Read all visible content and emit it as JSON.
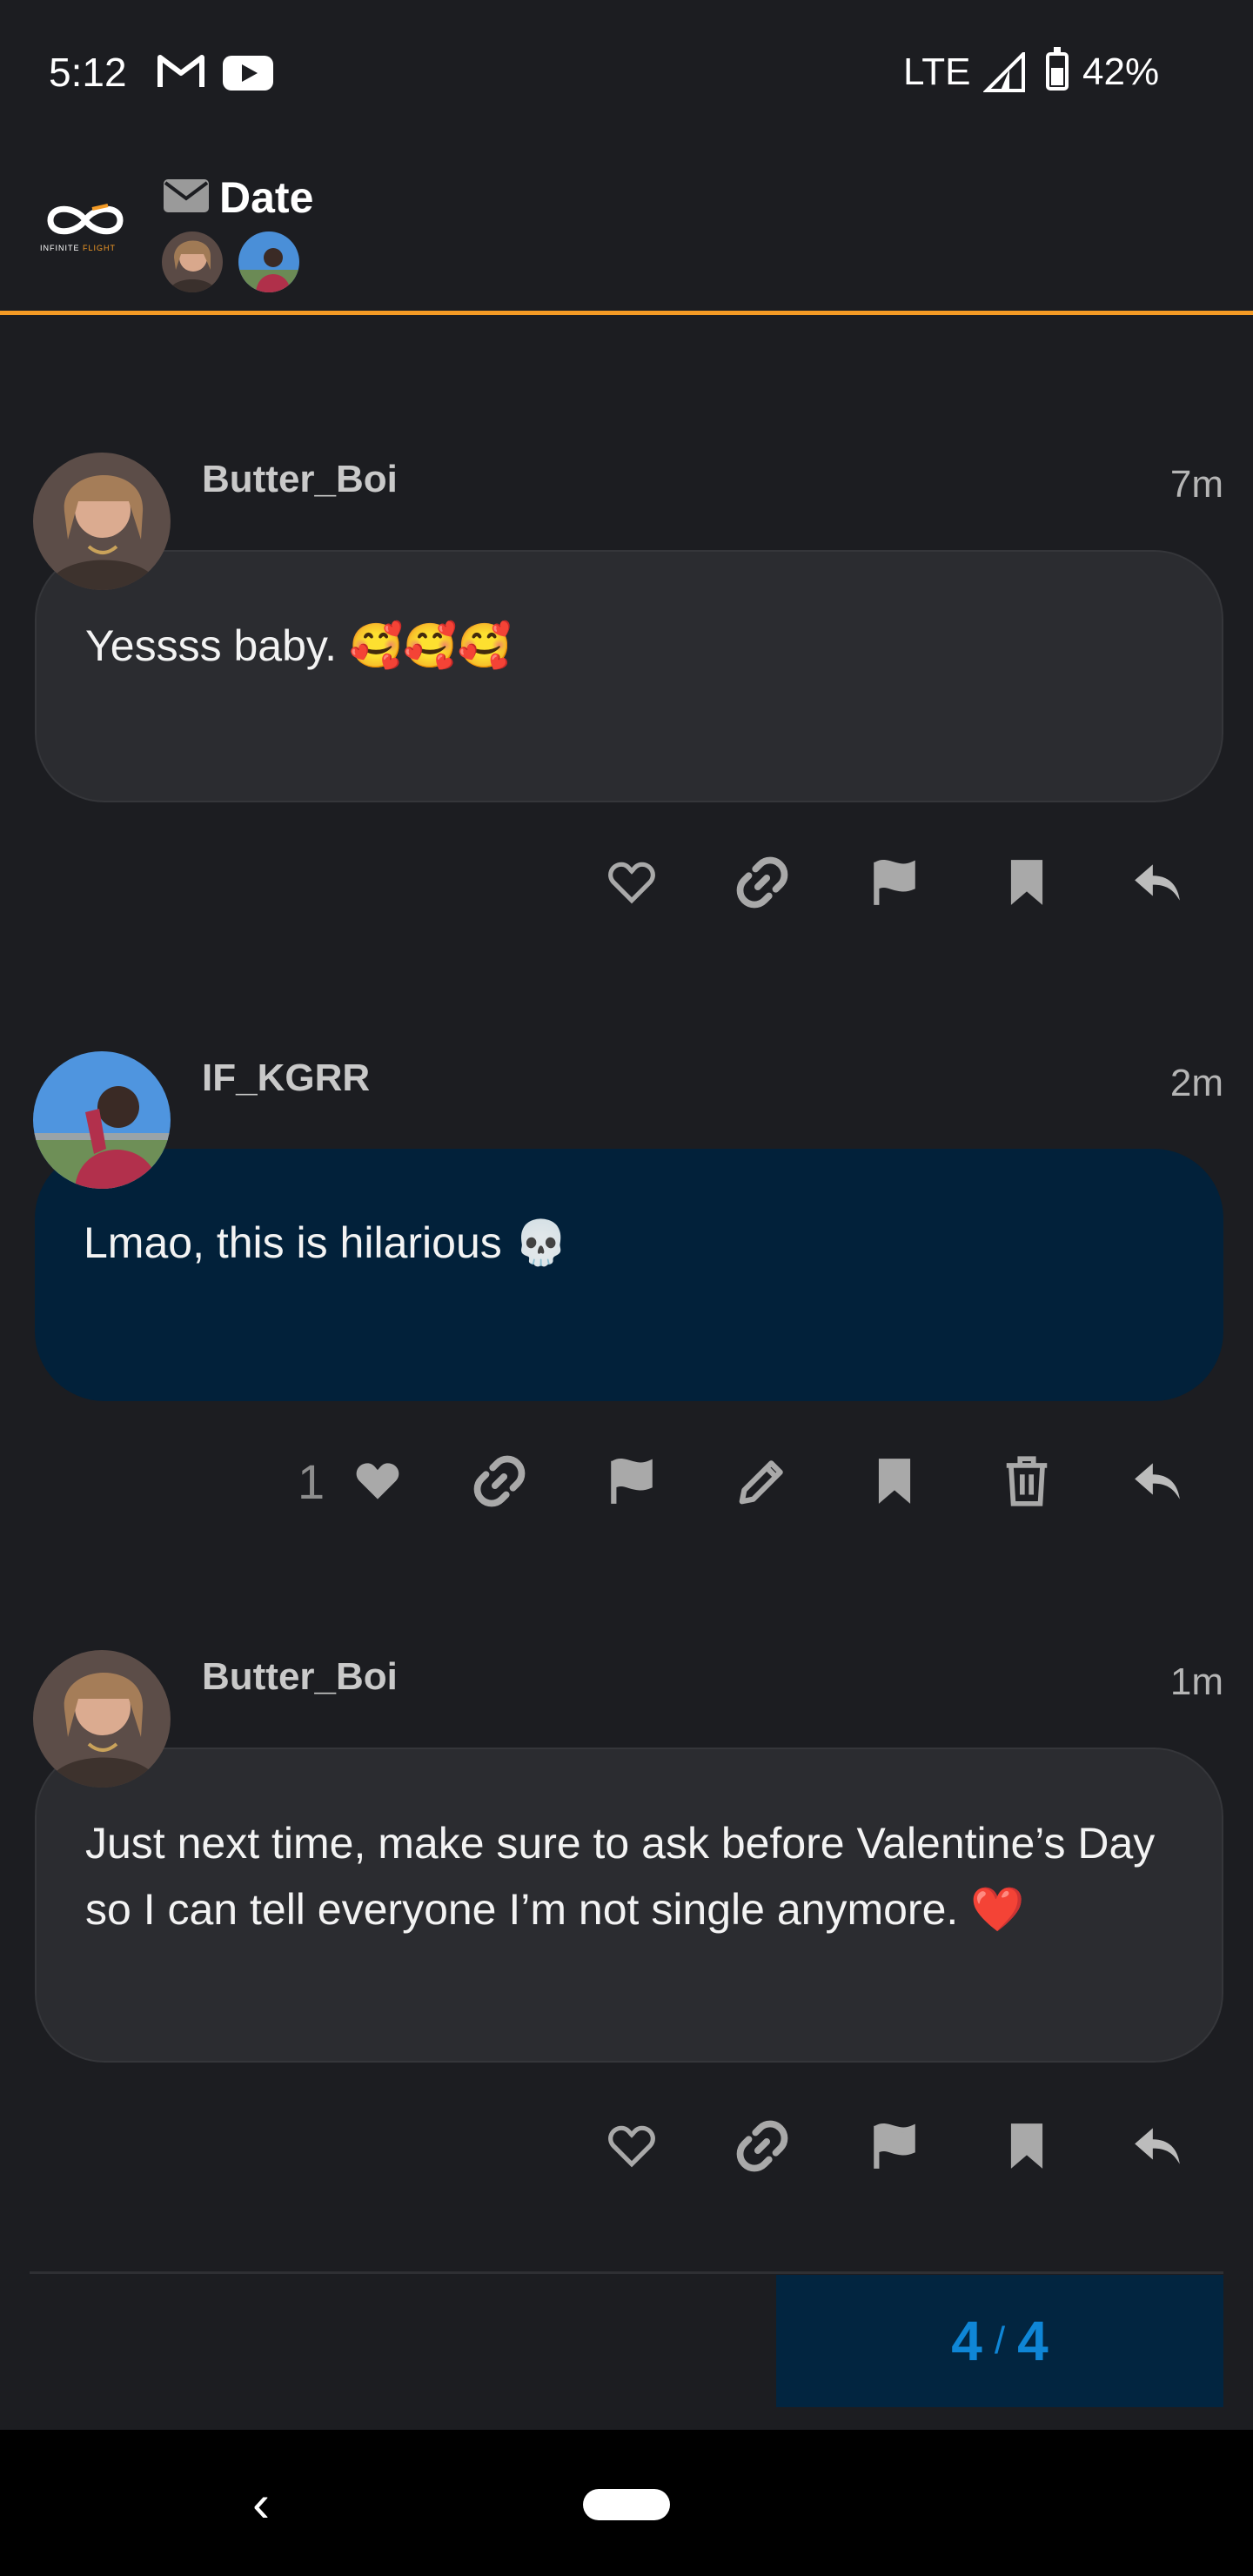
{
  "status_bar": {
    "time": "5:12",
    "network": "LTE",
    "battery": "42%",
    "notification_icons": [
      "gmail-icon",
      "youtube-icon"
    ]
  },
  "header": {
    "logo_brand_left": "INFINITE ",
    "logo_brand_right": "FLIGHT",
    "title": "Date",
    "title_icon": "envelope-icon",
    "accent_color": "#f39a25"
  },
  "posts": [
    {
      "username": "Butter_Boi",
      "time": "7m",
      "body": "Yessss baby. 🥰🥰🥰",
      "style": "grey",
      "actions": [
        "like-icon",
        "link-icon",
        "flag-icon",
        "bookmark-icon",
        "reply-icon"
      ]
    },
    {
      "username": "IF_KGRR",
      "time": "2m",
      "body": "Lmao, this is hilarious 💀",
      "style": "blue",
      "likes": "1",
      "actions": [
        "like-icon",
        "link-icon",
        "flag-icon",
        "edit-icon",
        "bookmark-icon",
        "delete-icon",
        "reply-icon"
      ]
    },
    {
      "username": "Butter_Boi",
      "time": "1m",
      "body": "Just next time, make sure to ask before Valentine’s Day so I can tell everyone I’m not single anymore. ❤️",
      "style": "grey",
      "actions": [
        "like-icon",
        "link-icon",
        "flag-icon",
        "bookmark-icon",
        "reply-icon"
      ]
    }
  ],
  "progress": {
    "current": "4",
    "separator": "/",
    "total": "4"
  },
  "colors": {
    "background": "#1c1d21",
    "bubble_grey": "#2b2c30",
    "bubble_blue": "#02213a",
    "progress_blue": "#0f86d6"
  }
}
